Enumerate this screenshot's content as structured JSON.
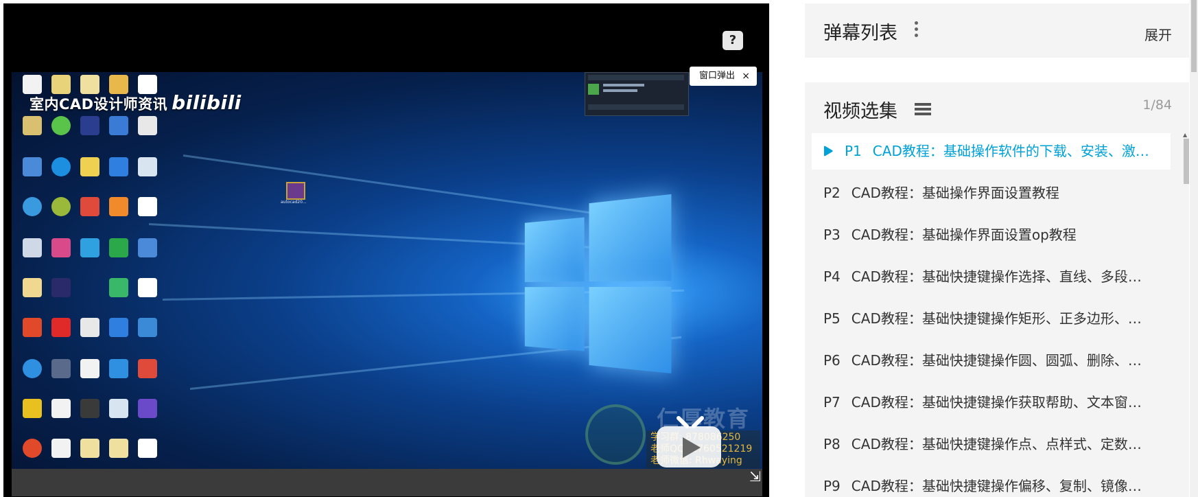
{
  "player": {
    "watermark_title": "室内CAD设计师资讯",
    "watermark_logo": "bilibili",
    "help_label": "?",
    "popup_label": "窗口弹出",
    "popup_close": "×",
    "brand_name": "仁厚教育",
    "brand_info": [
      "学习群: 878086250",
      "老师QQ: 1760521219",
      "老师微信: Rhwaying"
    ],
    "desktop_file_label": "autocad20..."
  },
  "danmaku": {
    "title": "弹幕列表",
    "expand_label": "展开"
  },
  "episodes": {
    "title": "视频选集",
    "count": "1/84",
    "items": [
      {
        "num": "P1",
        "title": "CAD教程：基础操作软件的下载、安装、激…",
        "active": true
      },
      {
        "num": "P2",
        "title": "CAD教程：基础操作界面设置教程",
        "active": false
      },
      {
        "num": "P3",
        "title": "CAD教程：基础操作界面设置op教程",
        "active": false
      },
      {
        "num": "P4",
        "title": "CAD教程：基础快捷键操作选择、直线、多段…",
        "active": false
      },
      {
        "num": "P5",
        "title": "CAD教程：基础快捷键操作矩形、正多边形、…",
        "active": false
      },
      {
        "num": "P6",
        "title": "CAD教程：基础快捷键操作圆、圆弧、删除、…",
        "active": false
      },
      {
        "num": "P7",
        "title": "CAD教程：基础快捷键操作获取帮助、文本窗…",
        "active": false
      },
      {
        "num": "P8",
        "title": "CAD教程：基础快捷键操作点、点样式、定数…",
        "active": false
      },
      {
        "num": "P9",
        "title": "CAD教程：基础快捷键操作偏移、复制、镜像…",
        "active": false
      }
    ]
  },
  "colors": {
    "accent": "#00a1d6",
    "panel_bg": "#f4f4f4"
  },
  "icons": [
    "help-icon",
    "close-icon",
    "more-vert-icon",
    "list-icon",
    "play-icon",
    "tv-icon",
    "resize-icon"
  ]
}
